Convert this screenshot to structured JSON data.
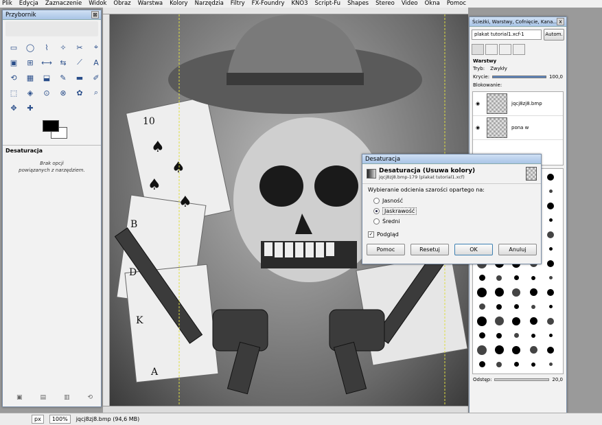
{
  "menubar": {
    "items": [
      "Plik",
      "Edycja",
      "Zaznaczenie",
      "Widok",
      "Obraz",
      "Warstwa",
      "Kolory",
      "Narzędzia",
      "Filtry",
      "FX-Foundry",
      "KNO3",
      "Script-Fu",
      "Shapes",
      "Stereo",
      "Video",
      "Okna",
      "Pomoc"
    ]
  },
  "toolbox": {
    "title": "Przybornik",
    "close": "⊠",
    "section_title": "Desaturacja",
    "note_line1": "Brak opcji",
    "note_line2": "powiązanych z narzędziem.",
    "tools": [
      "▭",
      "◯",
      "⌇",
      "✧",
      "✂",
      "⌖",
      "▣",
      "⊞",
      "⟷",
      "⇆",
      "⟋",
      "A",
      "⟲",
      "▦",
      "⬓",
      "✎",
      "▬",
      "✐",
      "⬚",
      "◈",
      "⊙",
      "⊗",
      "✿",
      "⌕",
      "✥",
      "✚"
    ]
  },
  "desaturate": {
    "title": "Desaturacja",
    "heading": "Desaturacja (Usuwa kolory)",
    "subtitle": "jqcj8zj8.bmp-179 (plakat tutorial1.xcf)",
    "group_label": "Wybieranie odcienia szarości opartego na:",
    "options": [
      "Jasność",
      "Jaskrawość",
      "Średni"
    ],
    "selected": "Jaskrawość",
    "preview_label": "Podgląd",
    "preview_checked": true,
    "buttons": {
      "help": "Pomoc",
      "reset": "Resetuj",
      "ok": "OK",
      "cancel": "Anuluj"
    }
  },
  "layers_dock": {
    "title": "Ścieżki, Warstwy, Cofnięcie, Kana...",
    "image_select": "plakat tutorial1.xcf-1",
    "auto_button": "Autom.",
    "panel_label": "Warstwy",
    "mode_label": "Tryb:",
    "mode_value": "Zwykły",
    "opacity_label": "Krycie:",
    "opacity_value": "100,0",
    "lock_label": "Blokowanie:",
    "layers": [
      {
        "name": "jqcj8zj8.bmp"
      },
      {
        "name": "pona w"
      }
    ],
    "spacing_label": "Odstęp:",
    "spacing_value": "20,0"
  },
  "status": {
    "unit": "px",
    "zoom": "100%",
    "info": "jqcj8zj8.bmp (94,6 MB)"
  },
  "colors": {
    "accent": "#a9c4e6",
    "canvas": "#8a8a8a"
  }
}
